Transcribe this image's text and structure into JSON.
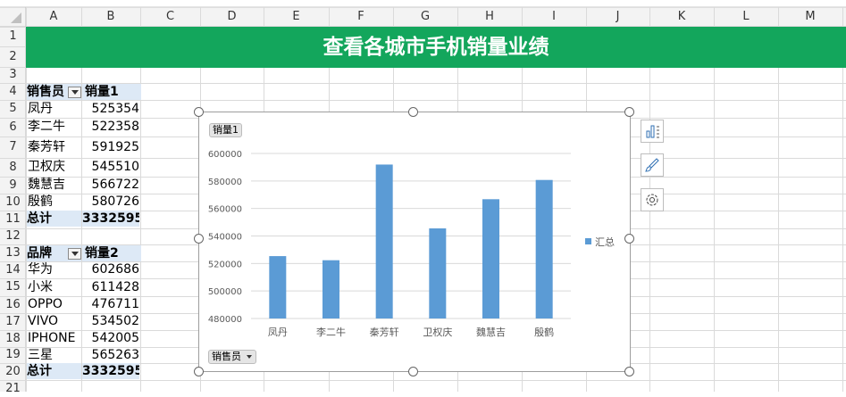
{
  "sheet": {
    "columns": [
      "A",
      "B",
      "C",
      "D",
      "E",
      "F",
      "G",
      "H",
      "I",
      "J",
      "K",
      "L",
      "M"
    ],
    "rows": [
      "1",
      "2",
      "3",
      "4",
      "5",
      "6",
      "7",
      "8",
      "9",
      "10",
      "11",
      "12",
      "13",
      "14",
      "15",
      "16",
      "17",
      "18",
      "19",
      "20",
      "21"
    ],
    "title": "查看各城市手机销量业绩",
    "pivot1": {
      "header_label": "销售员",
      "header_value": "销量1",
      "rows": [
        {
          "name": "凤丹",
          "value": "525354"
        },
        {
          "name": "李二牛",
          "value": "522358"
        },
        {
          "name": "秦芳轩",
          "value": "591925"
        },
        {
          "name": "卫权庆",
          "value": "545510"
        },
        {
          "name": "魏慧吉",
          "value": "566722"
        },
        {
          "name": "殷鹤",
          "value": "580726"
        }
      ],
      "total_label": "总计",
      "total_value": "3332595"
    },
    "pivot2": {
      "header_label": "品牌",
      "header_value": "销量2",
      "rows": [
        {
          "name": "华为",
          "value": "602686"
        },
        {
          "name": "小米",
          "value": "611428"
        },
        {
          "name": "OPPO",
          "value": "476711"
        },
        {
          "name": "VIVO",
          "value": "534502"
        },
        {
          "name": "IPHONE",
          "value": "542005"
        },
        {
          "name": "三星",
          "value": "565263"
        }
      ],
      "total_label": "总计",
      "total_value": "3332595"
    }
  },
  "chart_buttons": {
    "value_field": "销量1",
    "axis_field": "销售员",
    "side": [
      "chart-elements-icon",
      "chart-styles-brush-icon",
      "chart-filters-gear-icon"
    ]
  },
  "chart_data": {
    "type": "bar",
    "categories": [
      "凤丹",
      "李二牛",
      "秦芳轩",
      "卫权庆",
      "魏慧吉",
      "殷鹤"
    ],
    "series": [
      {
        "name": "汇总",
        "values": [
          525354,
          522358,
          591925,
          545510,
          566722,
          580726
        ],
        "color": "#5b9bd5"
      }
    ],
    "ylim": [
      480000,
      600000
    ],
    "yticks": [
      "480000",
      "500000",
      "520000",
      "540000",
      "560000",
      "580000",
      "600000"
    ],
    "grid": true,
    "legend": "right"
  },
  "colors": {
    "title_bg": "#13a65c",
    "pivot_header_bg": "#dde9f6",
    "bar": "#5b9bd5"
  }
}
